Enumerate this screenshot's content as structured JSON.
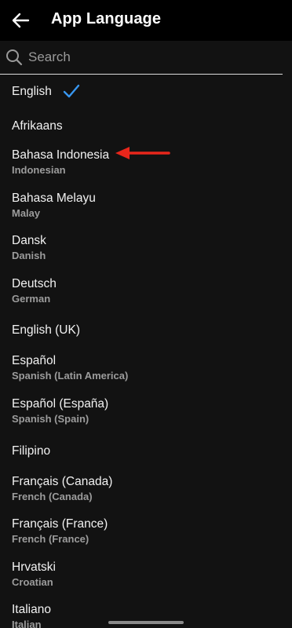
{
  "header": {
    "title": "App Language",
    "back_icon": "arrow-left-icon"
  },
  "search": {
    "placeholder": "Search",
    "value": "",
    "icon": "search-icon"
  },
  "colors": {
    "background": "#121212",
    "header": "#000000",
    "check": "#3897f0",
    "annotation_arrow": "#e8261b"
  },
  "languages": [
    {
      "native": "English",
      "english": "",
      "selected": true
    },
    {
      "native": "Afrikaans",
      "english": ""
    },
    {
      "native": "Bahasa Indonesia",
      "english": "Indonesian",
      "annotated": true
    },
    {
      "native": "Bahasa Melayu",
      "english": "Malay"
    },
    {
      "native": "Dansk",
      "english": "Danish"
    },
    {
      "native": "Deutsch",
      "english": "German"
    },
    {
      "native": "English (UK)",
      "english": ""
    },
    {
      "native": "Español",
      "english": "Spanish (Latin America)"
    },
    {
      "native": "Español (España)",
      "english": "Spanish (Spain)"
    },
    {
      "native": "Filipino",
      "english": ""
    },
    {
      "native": "Français (Canada)",
      "english": "French (Canada)"
    },
    {
      "native": "Français (France)",
      "english": "French (France)"
    },
    {
      "native": "Hrvatski",
      "english": "Croatian"
    },
    {
      "native": "Italiano",
      "english": "Italian"
    }
  ]
}
